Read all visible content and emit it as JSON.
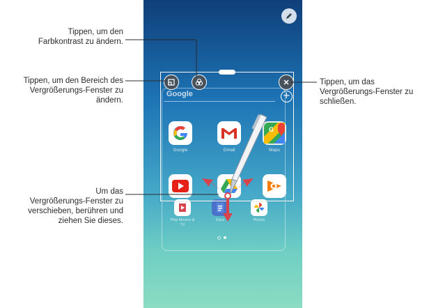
{
  "callouts": {
    "contrast": [
      "Tippen, um den",
      "Farbkontrast zu ändern."
    ],
    "area": [
      "Tippen, um den Bereich des",
      "Vergrößerungs-Fenster zu",
      "ändern."
    ],
    "close": [
      "Tippen, um das",
      "Vergrößerungs-Fenster zu",
      "schließen."
    ],
    "move": [
      "Um das",
      "Vergrößerungs-Fenster zu",
      "verschieben, berühren und",
      "ziehen Sie dieses."
    ]
  },
  "magnifier": {
    "google_text": "Google",
    "apps": [
      {
        "label": "Google",
        "icon": "google-icon"
      },
      {
        "label": "Gmail",
        "icon": "gmail-icon"
      },
      {
        "label": "Maps",
        "icon": "maps-icon"
      }
    ],
    "row2_icons": [
      "youtube-icon",
      "drive-icon",
      "play-music-icon"
    ]
  },
  "home": {
    "apps_bottom": [
      {
        "label": "Play Movies & TV",
        "icon": "play-movies-icon"
      },
      {
        "label": "Docs",
        "icon": "docs-icon"
      },
      {
        "label": "Photos",
        "icon": "photos-icon"
      }
    ]
  },
  "colors": {
    "bg_top": "#0f3f79",
    "bg_bottom": "#8bdcc2",
    "arrow": "#d9434c",
    "button_dark": "#47515c"
  }
}
